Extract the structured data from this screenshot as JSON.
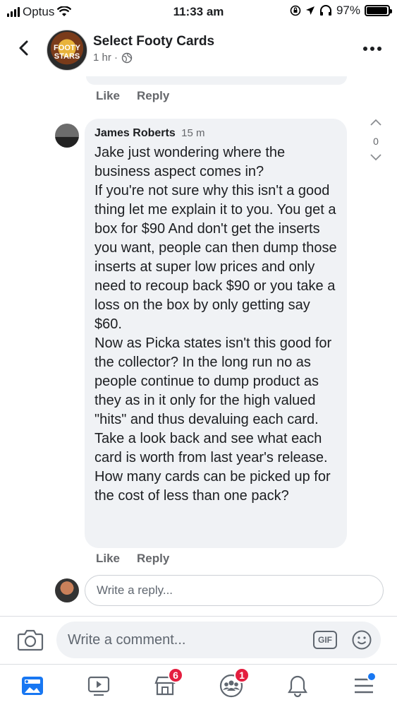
{
  "status_bar": {
    "carrier": "Optus",
    "time": "11:33 am",
    "battery": "97%",
    "battery_level": 0.97
  },
  "header": {
    "title": "Select Footy Cards",
    "meta": "1 hr ·",
    "avatar_text": "FOOTY STARS"
  },
  "previous_comment": {
    "like_label": "Like",
    "reply_label": "Reply"
  },
  "comment": {
    "author": "James Roberts",
    "time": "15 m",
    "text": "Jake just wondering where the business aspect comes in?\nIf you're not sure why this isn't a good thing let me explain it to you. You get a box for $90 And don't get the inserts you want, people can then dump those inserts at super low prices and only need to recoup back $90 or you take a loss on the box by only getting say $60.\nNow as Picka states isn't this good for the collector? In the long run no as people continue to dump product as they as in it only for the high valued \"hits\" and thus devaluing each card. Take a look back and see what each card is worth from last year's release.\nHow many cards can be picked up for the cost of less than one pack?",
    "vote_count": "0",
    "like_label": "Like",
    "reply_label": "Reply"
  },
  "reply_input": {
    "placeholder": "Write a reply..."
  },
  "composer": {
    "placeholder": "Write a comment...",
    "gif_label": "GIF"
  },
  "tab_bar": {
    "items": [
      {
        "icon": "news-feed-icon"
      },
      {
        "icon": "watch-icon"
      },
      {
        "icon": "marketplace-icon",
        "badge": "6"
      },
      {
        "icon": "groups-icon",
        "badge": "1"
      },
      {
        "icon": "bell-icon"
      },
      {
        "icon": "menu-icon"
      }
    ]
  },
  "colors": {
    "accent": "#1877f2",
    "badge": "#e41e3f",
    "bubble": "#f0f2f5",
    "secondary_text": "#65676b"
  }
}
